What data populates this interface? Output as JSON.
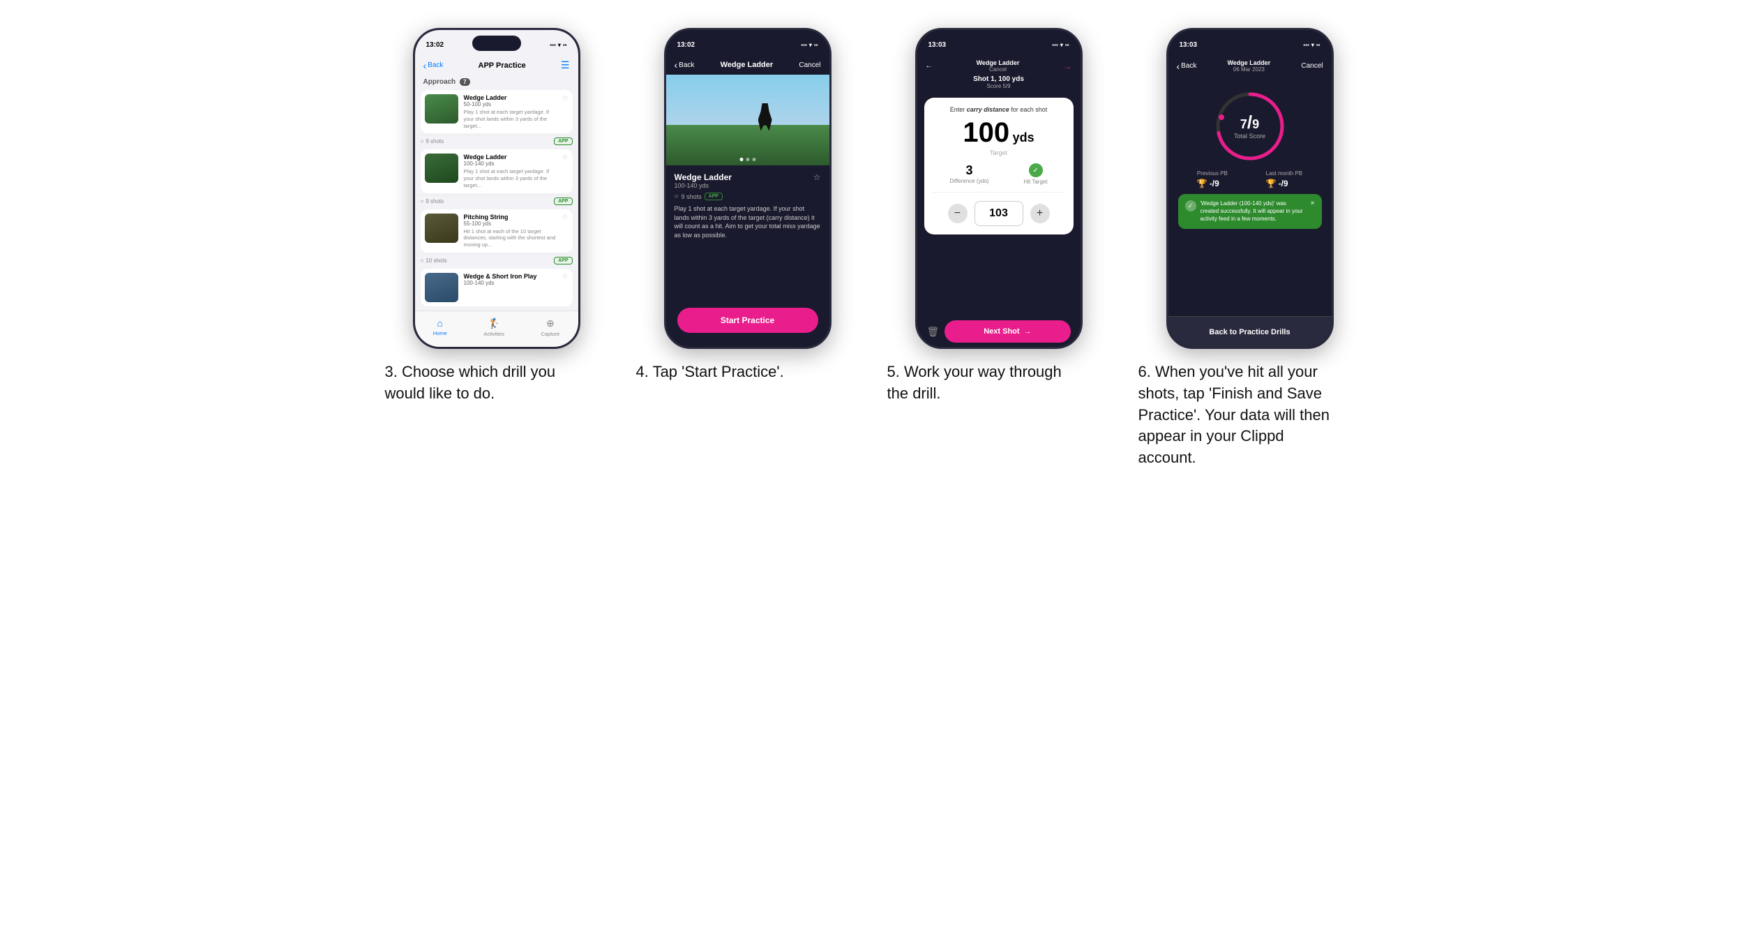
{
  "steps": [
    {
      "id": "step3",
      "caption": "3. Choose which drill you would like to do.",
      "phone": {
        "time": "13:02",
        "nav": {
          "back": "Back",
          "title": "APP Practice",
          "right_icon": "menu"
        },
        "section_label": "Approach",
        "section_badge": "7",
        "drills": [
          {
            "name": "Wedge Ladder",
            "range": "50-100 yds",
            "desc": "Play 1 shot at each target yardage. If your shot lands within 3 yards of the target...",
            "shots": "9 shots",
            "badge": "APP"
          },
          {
            "name": "Wedge Ladder",
            "range": "100-140 yds",
            "desc": "Play 1 shot at each target yardage. If your shot lands within 3 yards of the target...",
            "shots": "9 shots",
            "badge": "APP"
          },
          {
            "name": "Pitching String",
            "range": "55-100 yds",
            "desc": "Hit 1 shot at each of the 10 target distances, starting with the shortest and moving up...",
            "shots": "10 shots",
            "badge": "APP"
          },
          {
            "name": "Wedge & Short Iron Play",
            "range": "100-140 yds",
            "desc": "",
            "shots": "",
            "badge": ""
          }
        ],
        "tabs": [
          {
            "label": "Home",
            "icon": "🏠",
            "active": true
          },
          {
            "label": "Activities",
            "icon": "🏌️",
            "active": false
          },
          {
            "label": "Capture",
            "icon": "➕",
            "active": false
          }
        ]
      }
    },
    {
      "id": "step4",
      "caption": "4. Tap 'Start Practice'.",
      "phone": {
        "time": "13:02",
        "nav": {
          "back": "Back",
          "title": "Wedge Ladder",
          "right": "Cancel"
        },
        "drill_name": "Wedge Ladder",
        "drill_range": "100-140 yds",
        "drill_shots": "9 shots",
        "drill_badge": "APP",
        "drill_desc": "Play 1 shot at each target yardage. If your shot lands within 3 yards of the target (carry distance) it will count as a hit. Aim to get your total miss yardage as low as possible.",
        "start_btn": "Start Practice"
      }
    },
    {
      "id": "step5",
      "caption": "5. Work your way through the drill.",
      "phone": {
        "time": "13:03",
        "top_title": "Wedge Ladder",
        "top_cancel": "Cancel",
        "shot_label": "Shot 1, 100 yds",
        "score_label": "Score 5/9",
        "carry_instruction": "Enter carry distance for each shot",
        "target_value": "100",
        "target_unit": "yds",
        "target_label": "Target",
        "difference": "3",
        "difference_label": "Difference (yds)",
        "hit_target_label": "Hit Target",
        "input_value": "103",
        "next_shot_btn": "Next Shot"
      }
    },
    {
      "id": "step6",
      "caption": "6. When you've hit all your shots, tap 'Finish and Save Practice'. Your data will then appear in your Clippd account.",
      "phone": {
        "time": "13:03",
        "top_title": "Wedge Ladder",
        "top_date": "06 Mar 2023",
        "top_cancel": "Cancel",
        "score_value": "7",
        "score_total": "9",
        "score_label": "Total Score",
        "prev_pb_label": "Previous PB",
        "prev_pb_value": "-/9",
        "last_pb_label": "Last month PB",
        "last_pb_value": "-/9",
        "toast_text": "'Wedge Ladder (100-140 yds)' was created successfully. It will appear in your activity feed in a few moments.",
        "back_btn": "Back to Practice Drills"
      }
    }
  ]
}
